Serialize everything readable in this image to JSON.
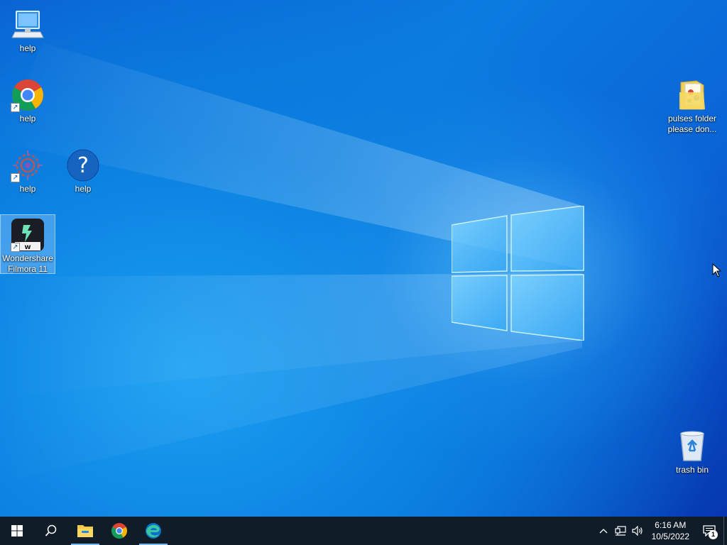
{
  "desktop": {
    "icons": [
      {
        "id": "this-pc",
        "label": "help",
        "icon": "computer-icon"
      },
      {
        "id": "chrome",
        "label": "help",
        "icon": "chrome-icon"
      },
      {
        "id": "app",
        "label": "help",
        "icon": "app-gear-icon"
      },
      {
        "id": "help",
        "label": "help",
        "icon": "help-question-icon"
      },
      {
        "id": "filmora",
        "label": "Wondershare Filmora 11",
        "icon": "filmora-icon",
        "selected": true
      },
      {
        "id": "folder",
        "label": "pulses folder please don...",
        "icon": "folder-icon"
      },
      {
        "id": "recycle",
        "label": "trash bin",
        "icon": "recycle-bin-icon"
      }
    ]
  },
  "taskbar": {
    "start": "start-icon",
    "search": "search-icon",
    "pinned": [
      "file-explorer-icon",
      "chrome-icon",
      "edge-icon"
    ],
    "tray": {
      "chevron": "^",
      "time": "6:16 AM",
      "date": "10/5/2022",
      "notification_count": "1"
    }
  },
  "colors": {
    "taskbar": "#101c27",
    "accent": "#76b9ed",
    "wallpaper": "#0b7fe0"
  }
}
